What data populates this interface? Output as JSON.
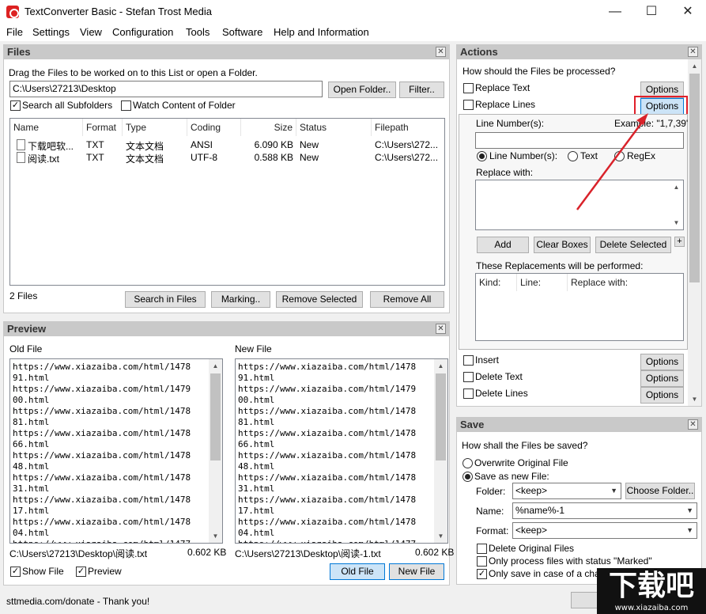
{
  "window": {
    "title": "TextConverter Basic - Stefan Trost Media",
    "min": "—",
    "max": "☐",
    "close": "✕"
  },
  "menu": [
    "File",
    "Settings",
    "View",
    "Configuration",
    "Tools",
    "Software",
    "Help and Information"
  ],
  "files": {
    "title": "Files",
    "hint": "Drag the Files to be worked on to this List or open a Folder.",
    "path_value": "C:\\Users\\27213\\Desktop",
    "open_folder": "Open Folder..",
    "filter": "Filter..",
    "search_subfolders": "Search all Subfolders",
    "search_subfolders_checked": true,
    "watch_content": "Watch Content of Folder",
    "watch_content_checked": false,
    "columns": [
      "Name",
      "Format",
      "Type",
      "Coding",
      "Size",
      "Status",
      "Filepath"
    ],
    "rows": [
      {
        "name": "下载吧软...",
        "format": "TXT",
        "type": "文本文档",
        "coding": "ANSI",
        "size": "6.090 KB",
        "status": "New",
        "path": "C:\\Users\\272..."
      },
      {
        "name": "阅读.txt",
        "format": "TXT",
        "type": "文本文档",
        "coding": "UTF-8",
        "size": "0.588 KB",
        "status": "New",
        "path": "C:\\Users\\272..."
      }
    ],
    "count": "2 Files",
    "search_in_files": "Search in Files",
    "marking": "Marking..",
    "remove_selected": "Remove Selected",
    "remove_all": "Remove All"
  },
  "preview": {
    "title": "Preview",
    "old_label": "Old File",
    "new_label": "New File",
    "old_text": "https://www.xiazaiba.com/html/1478\n91.html\nhttps://www.xiazaiba.com/html/1479\n00.html\nhttps://www.xiazaiba.com/html/1478\n81.html\nhttps://www.xiazaiba.com/html/1478\n66.html\nhttps://www.xiazaiba.com/html/1478\n48.html\nhttps://www.xiazaiba.com/html/1478\n31.html\nhttps://www.xiazaiba.com/html/1478\n17.html\nhttps://www.xiazaiba.com/html/1478\n04.html\nhttps://www.xiazaiba.com/html/1477",
    "new_text": "https://www.xiazaiba.com/html/1478\n91.html\nhttps://www.xiazaiba.com/html/1479\n00.html\nhttps://www.xiazaiba.com/html/1478\n81.html\nhttps://www.xiazaiba.com/html/1478\n66.html\nhttps://www.xiazaiba.com/html/1478\n48.html\nhttps://www.xiazaiba.com/html/1478\n31.html\nhttps://www.xiazaiba.com/html/1478\n17.html\nhttps://www.xiazaiba.com/html/1478\n04.html\nhttps://www.xiazaiba.com/html/1477",
    "old_path": "C:\\Users\\27213\\Desktop\\阅读.txt",
    "old_size": "0.602 KB",
    "new_path": "C:\\Users\\27213\\Desktop\\阅读-1.txt",
    "new_size": "0.602 KB",
    "show_file": "Show File",
    "preview_cb": "Preview",
    "old_file_btn": "Old File",
    "new_file_btn": "New File"
  },
  "actions": {
    "title": "Actions",
    "question": "How should the Files be processed?",
    "replace_text": "Replace Text",
    "replace_lines": "Replace Lines",
    "options": "Options",
    "line_numbers_label": "Line Number(s):",
    "example": "Example: \"1,7,39\"",
    "radio_line": "Line Number(s):",
    "radio_text": "Text",
    "radio_regex": "RegEx",
    "replace_with": "Replace with:",
    "add": "Add",
    "clear_boxes": "Clear Boxes",
    "delete_selected": "Delete Selected",
    "plus": "+",
    "performed": "These Replacements will be performed:",
    "cols": [
      "Kind:",
      "Line:",
      "Replace with:"
    ],
    "insert": "Insert",
    "delete_text": "Delete Text",
    "delete_lines": "Delete Lines"
  },
  "save": {
    "title": "Save",
    "question": "How shall the Files be saved?",
    "overwrite": "Overwrite Original File",
    "save_new": "Save as new File:",
    "folder_label": "Folder:",
    "folder_value": "<keep>",
    "choose_folder": "Choose Folder..",
    "name_label": "Name:",
    "name_value": "%name%-1",
    "format_label": "Format:",
    "format_value": "<keep>",
    "delete_original": "Delete Original Files",
    "only_marked": "Only process files with status \"Marked\"",
    "only_change": "Only save in case of a change"
  },
  "status": {
    "text": "sttmedia.com/donate - Thank you!"
  },
  "watermark": {
    "big": "下载吧",
    "small": "www.xiazaiba.com"
  },
  "colors": {
    "highlight": "#e0202a",
    "arrow": "#d9222a"
  }
}
